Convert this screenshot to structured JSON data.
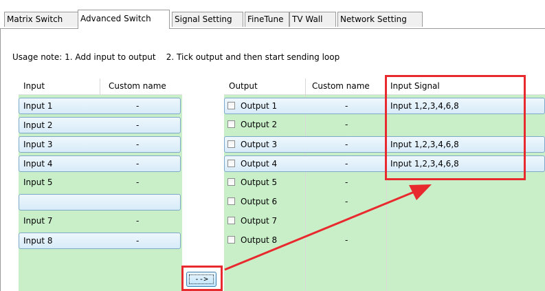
{
  "tabs": [
    {
      "label": "Matrix Switch"
    },
    {
      "label": "Advanced Switch"
    },
    {
      "label": "Signal Setting"
    },
    {
      "label": "FineTune"
    },
    {
      "label": "TV Wall"
    },
    {
      "label": "Network Setting"
    }
  ],
  "usage_note": "Usage note: 1. Add input to output    2. Tick output and then start sending loop",
  "input_table": {
    "headers": {
      "input": "Input",
      "custom": "Custom name"
    },
    "rows": [
      {
        "name": "Input   1",
        "custom": "-",
        "selected": true
      },
      {
        "name": "Input   2",
        "custom": "-",
        "selected": true
      },
      {
        "name": "Input   3",
        "custom": "-",
        "selected": true
      },
      {
        "name": "Input   4",
        "custom": "-",
        "selected": true
      },
      {
        "name": "Input   5",
        "custom": "-",
        "selected": false
      },
      {
        "name": "",
        "custom": "",
        "selected": true
      },
      {
        "name": "Input   7",
        "custom": "-",
        "selected": false
      },
      {
        "name": "Input   8",
        "custom": "-",
        "selected": true
      }
    ]
  },
  "output_table": {
    "headers": {
      "output": "Output",
      "custom": "Custom name",
      "signal": "Input Signal"
    },
    "rows": [
      {
        "name": "Output   1",
        "custom": "-",
        "signal": "Input 1,2,3,4,6,8",
        "selected": true
      },
      {
        "name": "Output   2",
        "custom": "-",
        "signal": "",
        "selected": false
      },
      {
        "name": "Output   3",
        "custom": "-",
        "signal": "Input 1,2,3,4,6,8",
        "selected": true
      },
      {
        "name": "Output   4",
        "custom": "-",
        "signal": "Input 1,2,3,4,6,8",
        "selected": true
      },
      {
        "name": "Output   5",
        "custom": "-",
        "signal": "",
        "selected": false
      },
      {
        "name": "Output   6",
        "custom": "-",
        "signal": "",
        "selected": false
      },
      {
        "name": "Output   7",
        "custom": "",
        "signal": "",
        "selected": false
      },
      {
        "name": "Output   8",
        "custom": "-",
        "signal": "",
        "selected": false
      }
    ]
  },
  "send_button": {
    "label": "-->"
  },
  "colors": {
    "annotation": "#e8292d",
    "panel_bg": "#c9efc9",
    "row_highlight": "#d7ebf8"
  }
}
